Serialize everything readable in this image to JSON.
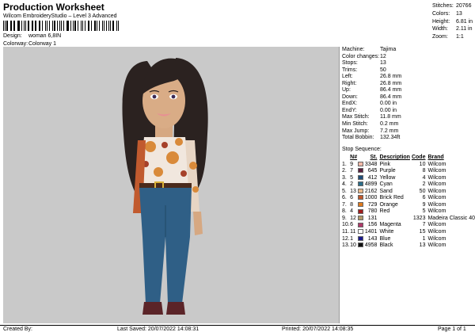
{
  "header": {
    "title": "Production Worksheet",
    "subtitle": "Wilcom EmbroideryStudio – Level 3 Advanced",
    "design_label": "Design:",
    "design_value": "woman 6,8IN",
    "colorway_label": "Colorway:",
    "colorway_value": "Colorway 1"
  },
  "summary": {
    "stitches_label": "Stitches:",
    "stitches_value": "20766",
    "colors_label": "Colors:",
    "colors_value": "13",
    "height_label": "Height:",
    "height_value": "6.81 in",
    "width_label": "Width:",
    "width_value": "2.11 in",
    "zoom_label": "Zoom:",
    "zoom_value": "1:1"
  },
  "specs": [
    {
      "label": "Machine:",
      "value": "Tajima"
    },
    {
      "label": "Color changes:",
      "value": "12"
    },
    {
      "label": "Stops:",
      "value": "13"
    },
    {
      "label": "Trims:",
      "value": "50"
    },
    {
      "label": "Left:",
      "value": "26.8 mm"
    },
    {
      "label": "Right:",
      "value": "26.8 mm"
    },
    {
      "label": "Up:",
      "value": "86.4 mm"
    },
    {
      "label": "Down:",
      "value": "86.4 mm"
    },
    {
      "label": "EndX:",
      "value": "0.00 in"
    },
    {
      "label": "EndY:",
      "value": "0.00 in"
    },
    {
      "label": "Max Stitch:",
      "value": "11.8 mm"
    },
    {
      "label": "Min Stitch:",
      "value": "0.2 mm"
    },
    {
      "label": "Max Jump:",
      "value": "7.2 mm"
    },
    {
      "label": "Total Bobbin:",
      "value": "132.34ft"
    }
  ],
  "stop_sequence": {
    "title": "Stop Sequence:",
    "headers": {
      "n": "N#",
      "st": "St.",
      "desc": "Description",
      "code": "Code",
      "brand": "Brand"
    },
    "rows": [
      {
        "num": "1.",
        "n": "9",
        "color": "#f3b9a8",
        "st": "3348",
        "desc": "Pink",
        "code": "10",
        "brand": "Wilcom"
      },
      {
        "num": "2.",
        "n": "7",
        "color": "#5a1f3c",
        "st": "645",
        "desc": "Purple",
        "code": "8",
        "brand": "Wilcom"
      },
      {
        "num": "3.",
        "n": "5",
        "color": "#1f4e79",
        "st": "412",
        "desc": "Yellow",
        "code": "4",
        "brand": "Wilcom"
      },
      {
        "num": "4.",
        "n": "2",
        "color": "#2c6e8a",
        "st": "4899",
        "desc": "Cyan",
        "code": "2",
        "brand": "Wilcom"
      },
      {
        "num": "5.",
        "n": "13",
        "color": "#e8b88a",
        "st": "2162",
        "desc": "Sand",
        "code": "50",
        "brand": "Wilcom"
      },
      {
        "num": "6.",
        "n": "6",
        "color": "#c0572a",
        "st": "1000",
        "desc": "Brick Red",
        "code": "6",
        "brand": "Wilcom"
      },
      {
        "num": "7.",
        "n": "8",
        "color": "#e07a1e",
        "st": "729",
        "desc": "Orange",
        "code": "9",
        "brand": "Wilcom"
      },
      {
        "num": "8.",
        "n": "4",
        "color": "#a11d1d",
        "st": "780",
        "desc": "Red",
        "code": "5",
        "brand": "Wilcom"
      },
      {
        "num": "9.",
        "n": "12",
        "color": "#b29a6a",
        "st": "131",
        "desc": "",
        "code": "1323",
        "brand": "Madeira Classic 40"
      },
      {
        "num": "10.",
        "n": "6",
        "color": "#b03a6a",
        "st": "156",
        "desc": "Magenta",
        "code": "7",
        "brand": "Wilcom"
      },
      {
        "num": "11.",
        "n": "11",
        "color": "#ffffff",
        "st": "1401",
        "desc": "White",
        "code": "15",
        "brand": "Wilcom"
      },
      {
        "num": "12.",
        "n": "1",
        "color": "#1a1a8c",
        "st": "143",
        "desc": "Blue",
        "code": "1",
        "brand": "Wilcom"
      },
      {
        "num": "13.",
        "n": "10",
        "color": "#111111",
        "st": "4958",
        "desc": "Black",
        "code": "13",
        "brand": "Wilcom"
      }
    ]
  },
  "footer": {
    "created": "Created By:",
    "saved": "Last Saved: 20/07/2022 14:08:31",
    "printed": "Printed: 20/07/2022 14:08:35",
    "page": "Page 1 of 1"
  }
}
